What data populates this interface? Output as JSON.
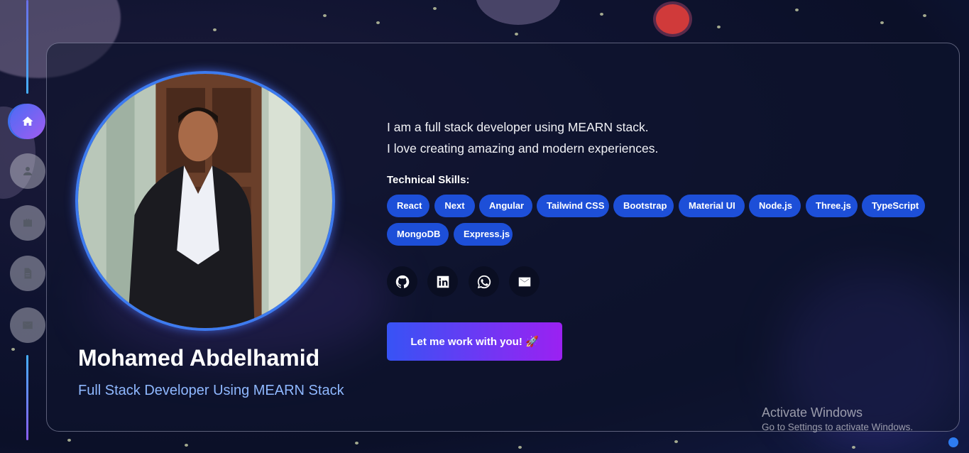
{
  "nav": {
    "items": [
      {
        "icon": "home-icon",
        "active": true
      },
      {
        "icon": "user-icon",
        "active": false
      },
      {
        "icon": "briefcase-icon",
        "active": false
      },
      {
        "icon": "document-icon",
        "active": false
      },
      {
        "icon": "mail-icon",
        "active": false
      }
    ]
  },
  "profile": {
    "name": "Mohamed Abdelhamid",
    "role": "Full Stack Developer Using MEARN Stack"
  },
  "bio": {
    "line1": "I am a full stack developer using MEARN stack.",
    "line2": "I love creating amazing and modern experiences."
  },
  "skills": {
    "title": "Technical Skills:",
    "items": [
      "React",
      "Next",
      "Angular",
      "Tailwind CSS",
      "Bootstrap",
      "Material UI",
      "Node.js",
      "Three.js",
      "TypeScript",
      "MongoDB",
      "Express.js"
    ]
  },
  "socials": [
    "github-icon",
    "linkedin-icon",
    "whatsapp-icon",
    "email-icon"
  ],
  "cta": {
    "label": "Let me work with you! 🚀"
  },
  "windows_watermark": {
    "title": "Activate Windows",
    "subtitle": "Go to Settings to activate Windows."
  },
  "colors": {
    "accent": "#1d4fd8",
    "role_text": "#8fb8ff",
    "cta_start": "#3753f5",
    "cta_end": "#9b21f2"
  }
}
